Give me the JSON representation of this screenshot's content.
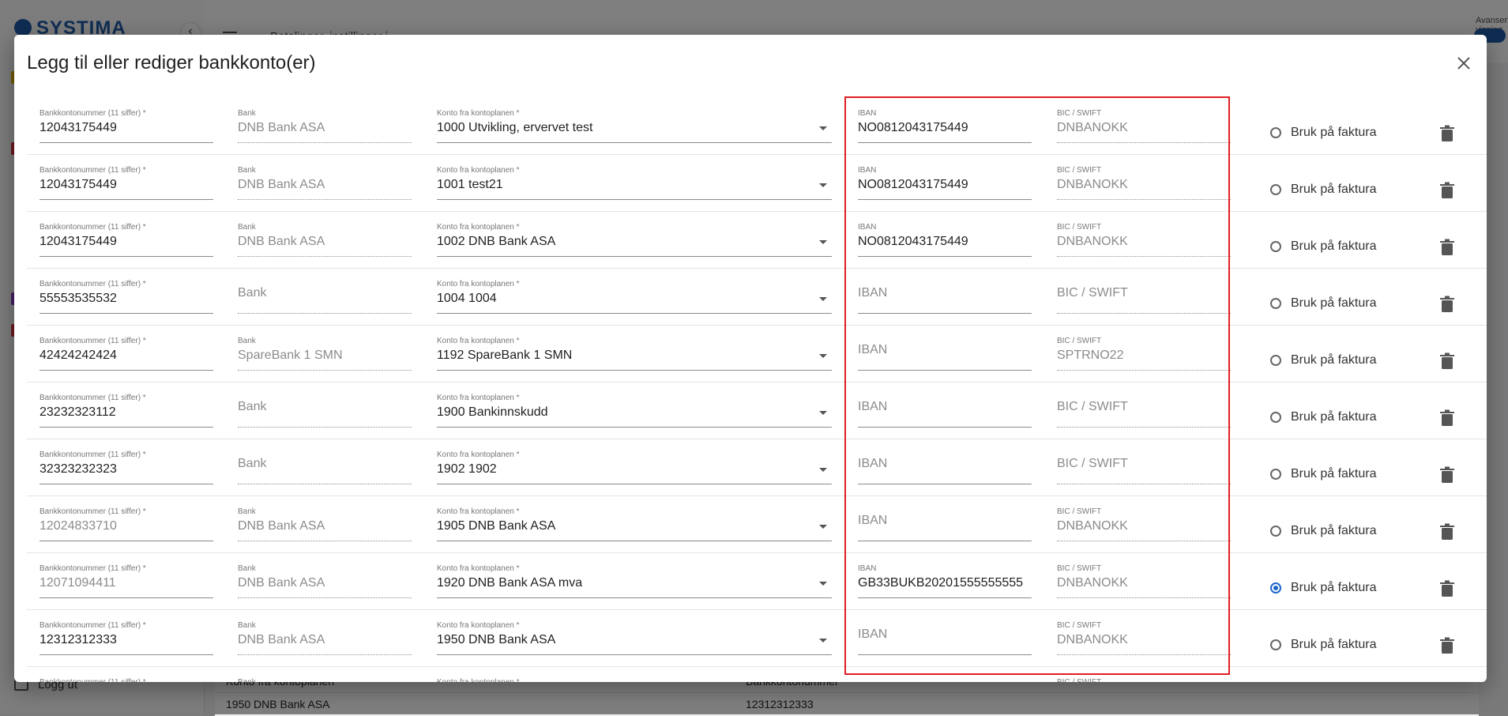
{
  "background": {
    "logo": "SYSTIMA",
    "breadcrumb": "Betalinger, instillinger i",
    "advanced_view_label": "Avansert visning",
    "logout_label": "Logg ut",
    "table": {
      "headers": [
        "Konto fra kontoplanen",
        "Bankkontonummer"
      ],
      "rows": [
        [
          "1950 DNB Bank ASA",
          "12312312333"
        ]
      ]
    }
  },
  "modal": {
    "title": "Legg til eller rediger bankkonto(er)",
    "labels": {
      "account_number": "Bankkontonummer (11 siffer) *",
      "bank": "Bank",
      "konto": "Konto fra kontoplanen *",
      "iban": "IBAN",
      "bic": "BIC / SWIFT",
      "use_on_invoice": "Bruk på faktura"
    },
    "rows": [
      {
        "account": "12043175449",
        "account_muted": false,
        "bank": "DNB Bank ASA",
        "konto": "1000 Utvikling, ervervet test",
        "iban": "NO0812043175449",
        "bic": "DNBANOKK",
        "selected": false
      },
      {
        "account": "12043175449",
        "account_muted": false,
        "bank": "DNB Bank ASA",
        "konto": "1001 test21",
        "iban": "NO0812043175449",
        "bic": "DNBANOKK",
        "selected": false
      },
      {
        "account": "12043175449",
        "account_muted": false,
        "bank": "DNB Bank ASA",
        "konto": "1002 DNB Bank ASA",
        "iban": "NO0812043175449",
        "bic": "DNBANOKK",
        "selected": false
      },
      {
        "account": "55553535532",
        "account_muted": false,
        "bank": "",
        "konto": "1004 1004",
        "iban": "",
        "bic": "",
        "selected": false
      },
      {
        "account": "42424242424",
        "account_muted": false,
        "bank": "SpareBank 1 SMN",
        "konto": "1192 SpareBank 1 SMN",
        "iban": "",
        "bic": "SPTRNO22",
        "selected": false
      },
      {
        "account": "23232323112",
        "account_muted": false,
        "bank": "",
        "konto": "1900 Bankinnskudd",
        "iban": "",
        "bic": "",
        "selected": false
      },
      {
        "account": "32323232323",
        "account_muted": false,
        "bank": "",
        "konto": "1902 1902",
        "iban": "",
        "bic": "",
        "selected": false
      },
      {
        "account": "12024833710",
        "account_muted": true,
        "bank": "DNB Bank ASA",
        "konto": "1905 DNB Bank ASA",
        "iban": "",
        "bic": "DNBANOKK",
        "selected": false
      },
      {
        "account": "12071094411",
        "account_muted": true,
        "bank": "DNB Bank ASA",
        "konto": "1920 DNB Bank ASA mva",
        "iban": "GB33BUKB20201555555555",
        "bic": "DNBANOKK",
        "selected": true
      },
      {
        "account": "12312312333",
        "account_muted": false,
        "bank": "DNB Bank ASA",
        "konto": "1950 DNB Bank ASA",
        "iban": "",
        "bic": "DNBANOKK",
        "selected": false
      }
    ]
  },
  "colors": {
    "highlight": "#e01e25",
    "radio_selected": "#1f66c9",
    "brand": "#1f5aa6"
  },
  "icons": {
    "close": "close-icon",
    "trash": "trash-icon",
    "dropdown": "chevron-down-icon"
  }
}
